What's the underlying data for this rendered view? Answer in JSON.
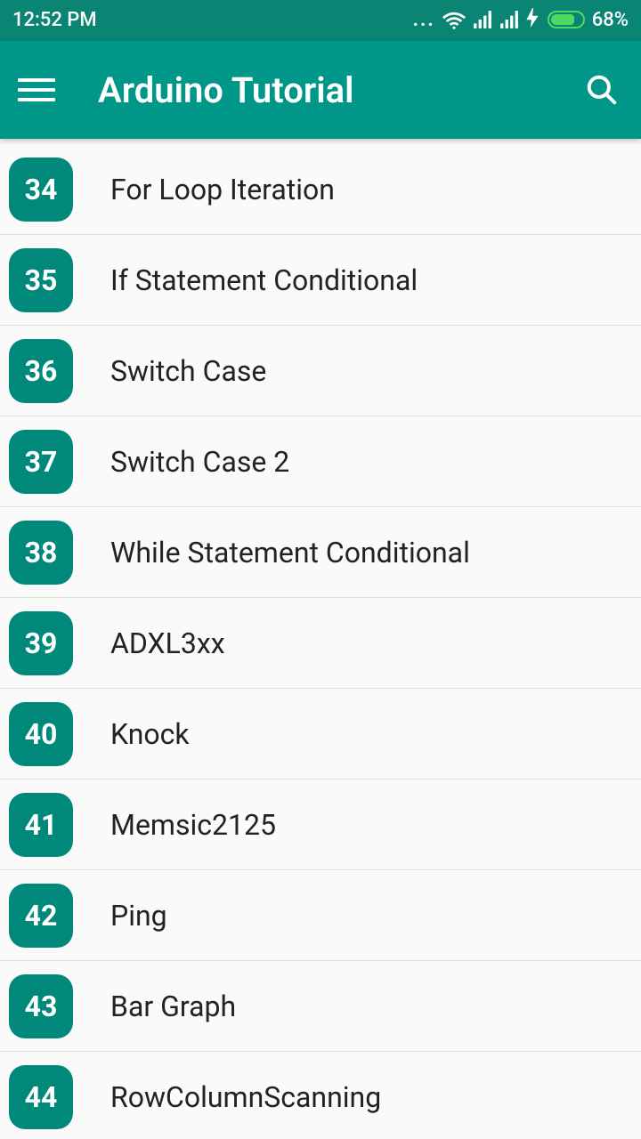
{
  "status": {
    "time": "12:52 PM",
    "battery_pct": "68%"
  },
  "appbar": {
    "title": "Arduino Tutorial"
  },
  "list": {
    "items": [
      {
        "num": "34",
        "label": "For Loop Iteration"
      },
      {
        "num": "35",
        "label": "If Statement Conditional"
      },
      {
        "num": "36",
        "label": "Switch Case"
      },
      {
        "num": "37",
        "label": "Switch Case 2"
      },
      {
        "num": "38",
        "label": "While Statement Conditional"
      },
      {
        "num": "39",
        "label": "ADXL3xx"
      },
      {
        "num": "40",
        "label": "Knock"
      },
      {
        "num": "41",
        "label": "Memsic2125"
      },
      {
        "num": "42",
        "label": "Ping"
      },
      {
        "num": "43",
        "label": "Bar Graph"
      },
      {
        "num": "44",
        "label": "RowColumnScanning"
      }
    ]
  }
}
